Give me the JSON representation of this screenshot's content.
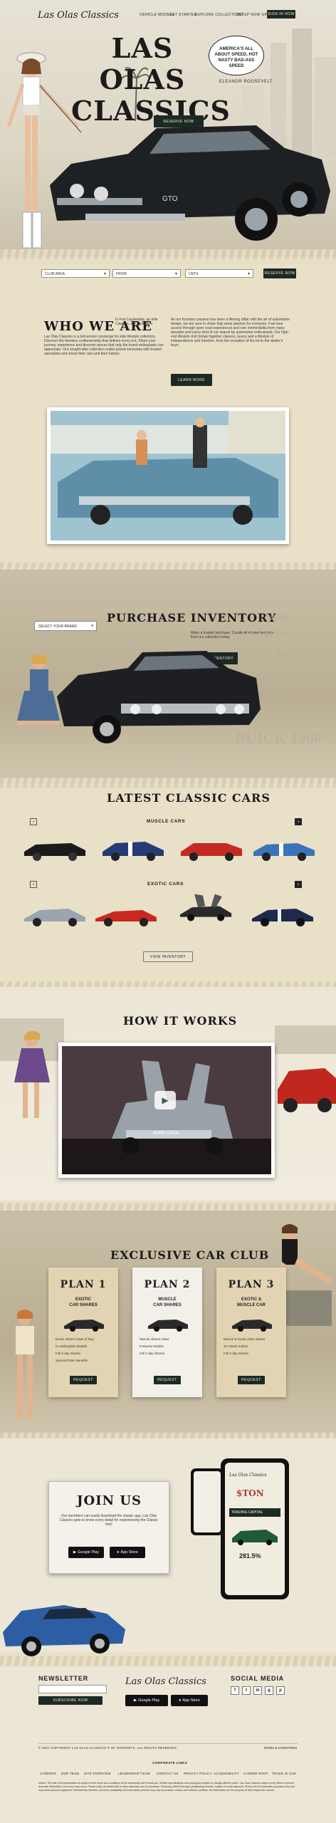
{
  "nav": {
    "logo": "Las Olas Classics",
    "links": [
      "VEHICLE MODELS",
      "GET STARTED",
      "EXPLORE COLLECTIONS",
      "SETUP NOW UPDATE"
    ],
    "signin": "SIGN IN NOW"
  },
  "hero": {
    "title_line1": "LAS OLAS",
    "title_line2": "CLASSICS",
    "bubble": "AMERICA'S ALL ABOUT SPEED, HOT NASTY BAD-ASS SPEED",
    "quote_author": "ELEANOR ROOSEVELT",
    "cta": "RESERVE NOW",
    "car_plate": "GTO"
  },
  "search": {
    "fields": [
      "CLUB AREA",
      "FROM",
      "UNTIL"
    ],
    "button": "RESERVE NOW"
  },
  "who": {
    "title": "WHO WE ARE",
    "subtitle": "In Fort Lauderdale, an elite Classics, as Creativity's",
    "body_left": "Las Olas Classics is a full-service concierge for elite lifestyle collectors. Discover the timeless craftsmanship that defines every era. Share your journey, experience and discover pieces that only the truest enthusiasts can appreciate. Our sought-after collection unites prized memories with trusted specialists who know their cars and their history.",
    "body_right": "As our founders passion has been a lifelong affair with the art of automotive design, we are sure to share that same passion for everyone. Fast lane access through open road experiences and rare memorabilia from many decades and every kind of car shared by automotive enthusiasts. Our high-end lifestyle club brings together classics, luxury and a lifestyle of independence and freedom, from the reception of the lot to the dealer's keys.",
    "button": "LEARN MORE"
  },
  "purchase": {
    "title": "PURCHASE INVENTORY",
    "select": "SELECT YOUR BRAND",
    "text": "Make a trusted purchase. Curate all of your beauties from our collection today.",
    "button": "VIEW INVENTORY",
    "brands": [
      "Cadillac",
      "BUICK",
      "RR",
      "M",
      "Ford",
      "BUICK 1960"
    ]
  },
  "latest": {
    "title": "LATEST CLASSIC CARS",
    "muscle_label": "MUSCLE CARS",
    "exotic_label": "EXOTIC CARS",
    "prev": "‹",
    "next": "›",
    "button": "VIEW INVENTORY"
  },
  "how": {
    "title": "HOW IT WORKS",
    "plate": "BMW GINA"
  },
  "club": {
    "title": "EXCLUSIVE CAR CLUB",
    "plans": [
      {
        "name": "PLAN 1",
        "sub1": "EXOTIC",
        "sub2": "CAR SHARES",
        "items": [
          "Exotic shares Class of Day",
          "8 Lamborghini Models",
          "Full 2 day Shares",
          "Special Order Benefits"
        ],
        "button": "REQUEST"
      },
      {
        "name": "PLAN 2",
        "sub1": "MUSCLE",
        "sub2": "CAR SHARES",
        "items": [
          "Muscle shares Class",
          "8 Muscle Models",
          "Full 2 day Shares"
        ],
        "button": "REQUEST"
      },
      {
        "name": "PLAN 3",
        "sub1": "EXOTIC &",
        "sub2": "MUSCLE CAR",
        "items": [
          "Muscle & Exotic class shares",
          "20 mixed models",
          "Full 2 day Shares"
        ],
        "button": "REQUEST"
      }
    ]
  },
  "join": {
    "title": "JOIN US",
    "text": "Our members can easily download the classic app, Las Olas Classics gets to know every detail for experiencing the Classic first!",
    "google": "Google Play",
    "apple": "App Store",
    "phone_title": "Las Olas Classics",
    "phone_price": "$TON",
    "phone_stat": "281.5%",
    "phone_banner": "TRADING CAPITAL"
  },
  "footer": {
    "newsletter_title": "NEWSLETTER",
    "newsletter_button": "SUBSCRIBE NOW",
    "logo": "Las Olas Classics",
    "google": "Google Play",
    "apple": "App Store",
    "social_title": "SOCIAL MEDIA",
    "social": [
      "f",
      "t",
      "in",
      "g",
      "p"
    ],
    "copyright": "© 2021 COPYRIGHT LAS OLAS CLASSICS ® OF CONTENTS. ALL RIGHTS RESERVED.",
    "terms": "TERMS & CONDITIONS",
    "corp_links": "CORPORATE LINKS",
    "links": [
      "CAREERS",
      "OUR TEAM",
      "SITE OVERVIEW",
      "LEADERSHIP TEAM",
      "CONTACT US",
      "PRIVACY POLICY",
      "ACCESSIBILITY",
      "CAREER ROOT",
      "TRADE IN CAR"
    ],
    "disclaimer": "Notice: The sale of all automobiles is subject to the terms and conditions of the dealership and Florida law. Vehicle specifications and pricing are subject to change without notice. Las Olas Classics makes every effort to present accurate information, but errors may occur. Please verify all details with a sales associate prior to purchase. Financing offered through participating lenders, subject to credit approval. Photos are for illustration purposes only and may show optional equipment. Membership benefits, car share availability and reservation periods may vary by location, season and vehicle condition. All trademarks are the property of their respective owners."
  },
  "colors": {
    "accent_dark": "#1d2a24",
    "paper": "#e9e0c8"
  }
}
